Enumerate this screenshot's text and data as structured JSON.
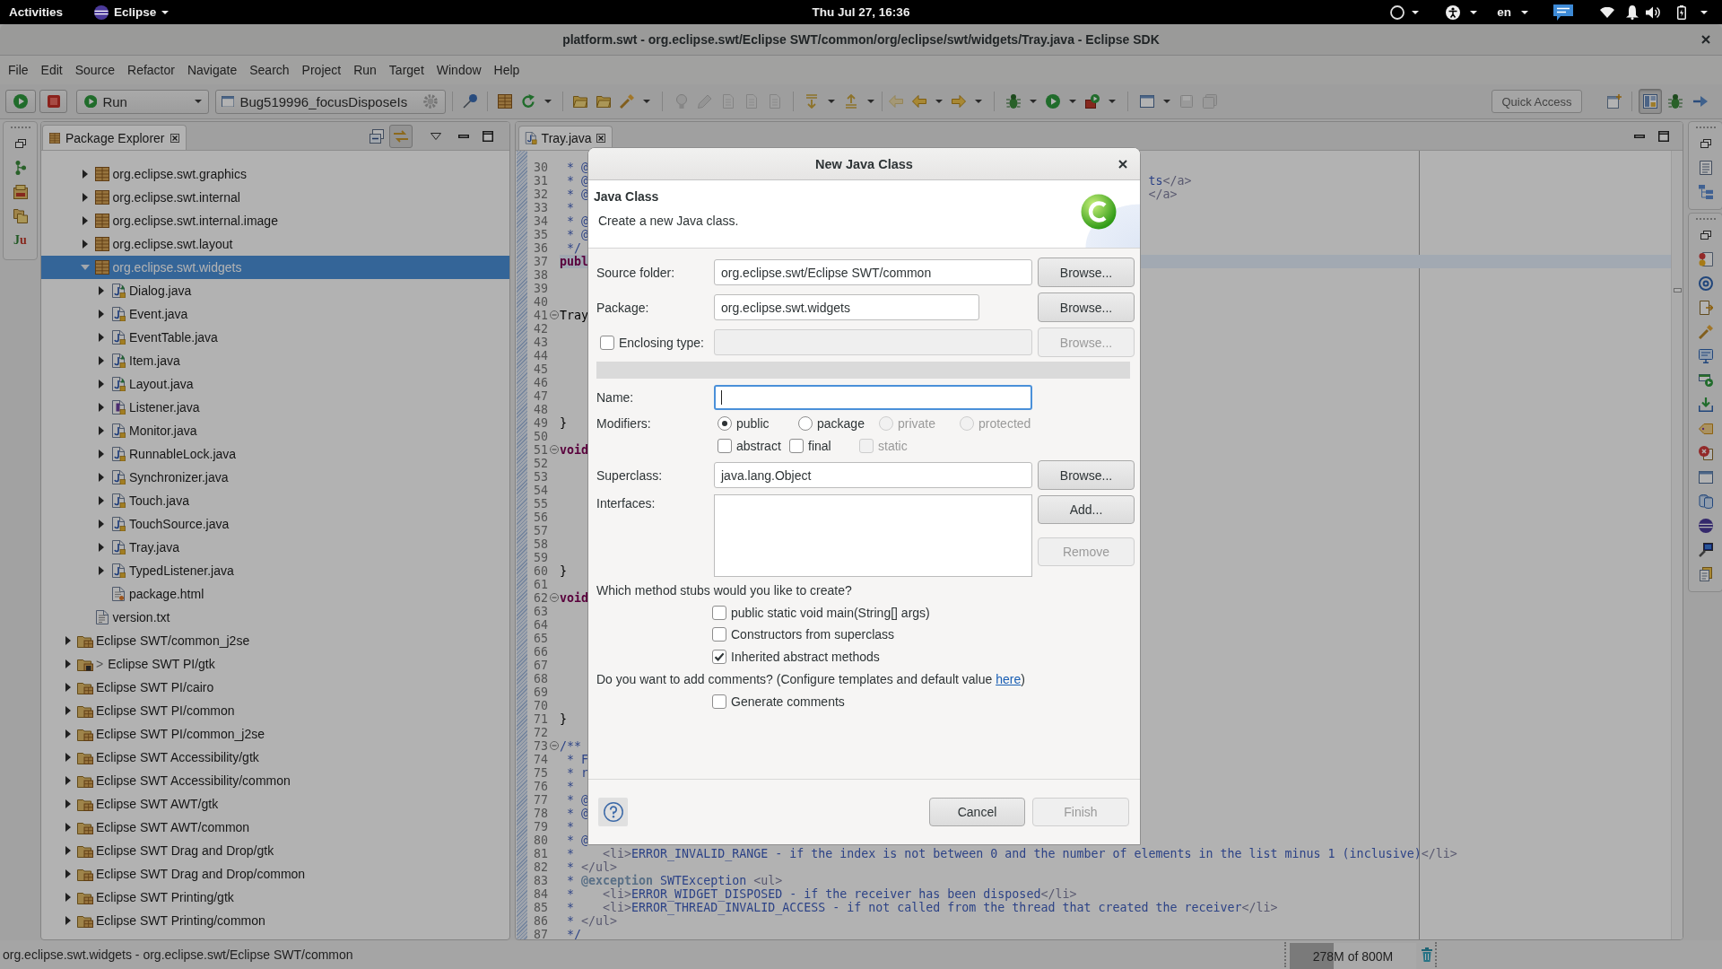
{
  "top_bar": {
    "activities": "Activities",
    "app_menu": "Eclipse",
    "clock": "Thu Jul 27, 16:36",
    "keyboard_layout": "en"
  },
  "window": {
    "title": "platform.swt - org.eclipse.swt/Eclipse SWT/common/org/eclipse/swt/widgets/Tray.java - Eclipse SDK"
  },
  "menu": [
    "File",
    "Edit",
    "Source",
    "Refactor",
    "Navigate",
    "Search",
    "Project",
    "Run",
    "Target",
    "Window",
    "Help"
  ],
  "toolbar": {
    "run_config": "Run",
    "launch_config": "Bug519996_focusDisposeIs",
    "quick_access": {
      "placeholder": "Quick Access"
    },
    "perspectives": [
      {
        "selected": true
      },
      {
        "selected": false
      },
      {
        "selected": false
      }
    ]
  },
  "left_trim": {
    "glyph": "Ju"
  },
  "package_explorer": {
    "tabs": [
      {
        "label": "Package Explorer",
        "selected": true
      }
    ],
    "view_toolbar": {
      "toggle_on": true
    },
    "tree": [
      {
        "children": [
          {
            "label": "org.eclipse.swt.graphics",
            "kind": "package",
            "expanded": false,
            "selected": false
          },
          {
            "label": "org.eclipse.swt.internal",
            "kind": "package",
            "expanded": false,
            "selected": false
          },
          {
            "label": "org.eclipse.swt.internal.image",
            "kind": "package",
            "expanded": false,
            "selected": false
          },
          {
            "label": "org.eclipse.swt.layout",
            "kind": "package",
            "expanded": false,
            "selected": false
          },
          {
            "label": "org.eclipse.swt.widgets",
            "kind": "package",
            "expanded": true,
            "selected": true,
            "children": [
              {
                "label": "Dialog.java",
                "kind": "abstract-class",
                "expanded": false,
                "selected": false
              },
              {
                "label": "Event.java",
                "kind": "class",
                "expanded": false,
                "selected": false
              },
              {
                "label": "EventTable.java",
                "kind": "class",
                "expanded": false,
                "selected": false
              },
              {
                "label": "Item.java",
                "kind": "abstract-class",
                "expanded": false,
                "selected": false
              },
              {
                "label": "Layout.java",
                "kind": "abstract-class",
                "expanded": false,
                "selected": false
              },
              {
                "label": "Listener.java",
                "kind": "interface",
                "expanded": false,
                "selected": false
              },
              {
                "label": "Monitor.java",
                "kind": "class",
                "expanded": false,
                "selected": false
              },
              {
                "label": "RunnableLock.java",
                "kind": "class",
                "expanded": false,
                "selected": false
              },
              {
                "label": "Synchronizer.java",
                "kind": "class",
                "expanded": false,
                "selected": false
              },
              {
                "label": "Touch.java",
                "kind": "class",
                "expanded": false,
                "selected": false
              },
              {
                "label": "TouchSource.java",
                "kind": "class",
                "expanded": false,
                "selected": false
              },
              {
                "label": "Tray.java",
                "kind": "class",
                "expanded": false,
                "selected": false
              },
              {
                "label": "TypedListener.java",
                "kind": "class",
                "expanded": false,
                "selected": false
              },
              {
                "label": "package.html",
                "kind": "html-file",
                "selected": false
              }
            ]
          },
          {
            "label": "version.txt",
            "kind": "text-file",
            "selected": false
          }
        ]
      },
      {
        "label": "Eclipse SWT/common_j2se",
        "kind": "source-folder",
        "expanded": false,
        "selected": false
      },
      {
        "label": "Eclipse SWT PI/gtk",
        "decoration": ">",
        "kind": "changed-source-folder",
        "expanded": false,
        "selected": false
      },
      {
        "label": "Eclipse SWT PI/cairo",
        "kind": "source-folder",
        "expanded": false,
        "selected": false
      },
      {
        "label": "Eclipse SWT PI/common",
        "kind": "source-folder",
        "expanded": false,
        "selected": false
      },
      {
        "label": "Eclipse SWT PI/common_j2se",
        "kind": "source-folder",
        "expanded": false,
        "selected": false
      },
      {
        "label": "Eclipse SWT Accessibility/gtk",
        "kind": "source-folder",
        "expanded": false,
        "selected": false
      },
      {
        "label": "Eclipse SWT Accessibility/common",
        "kind": "source-folder",
        "expanded": false,
        "selected": false
      },
      {
        "label": "Eclipse SWT AWT/gtk",
        "kind": "source-folder",
        "expanded": false,
        "selected": false
      },
      {
        "label": "Eclipse SWT AWT/common",
        "kind": "source-folder",
        "expanded": false,
        "selected": false
      },
      {
        "label": "Eclipse SWT Drag and Drop/gtk",
        "kind": "source-folder",
        "expanded": false,
        "selected": false
      },
      {
        "label": "Eclipse SWT Drag and Drop/common",
        "kind": "source-folder",
        "expanded": false,
        "selected": false
      },
      {
        "label": "Eclipse SWT Printing/gtk",
        "kind": "source-folder",
        "expanded": false,
        "selected": false
      },
      {
        "label": "Eclipse SWT Printing/common",
        "kind": "source-folder",
        "expanded": false,
        "selected": false
      }
    ]
  },
  "editor": {
    "tabs": [
      {
        "label": "Tray.java",
        "selected": true
      }
    ],
    "lines": [
      {
        "number": "30",
        "text": " * @",
        "kind": "comment",
        "current": false
      },
      {
        "number": "31",
        "text": " * @",
        "right": "ts</a>",
        "kind": "comment",
        "current": false
      },
      {
        "number": "32",
        "text": " * @",
        "right": "</a>",
        "kind": "comment",
        "current": false
      },
      {
        "number": "33",
        "text": " *",
        "kind": "comment",
        "current": false
      },
      {
        "number": "34",
        "text": " * @",
        "kind": "comment",
        "current": false
      },
      {
        "number": "35",
        "text": " * @",
        "kind": "comment",
        "current": false
      },
      {
        "number": "36",
        "text": " */",
        "kind": "comment",
        "current": false
      },
      {
        "number": "37",
        "text": "publ",
        "kind": "keyword",
        "current": true
      },
      {
        "number": "38",
        "current": false
      },
      {
        "number": "39",
        "current": false
      },
      {
        "number": "40",
        "current": false
      },
      {
        "number": "41",
        "text": "Tray",
        "kind": "code",
        "fold_expanded": true,
        "current": false
      },
      {
        "number": "42",
        "current": false
      },
      {
        "number": "43",
        "current": false
      },
      {
        "number": "44",
        "current": false
      },
      {
        "number": "45",
        "current": false
      },
      {
        "number": "46",
        "current": false
      },
      {
        "number": "47",
        "current": false
      },
      {
        "number": "48",
        "current": false
      },
      {
        "number": "49",
        "text": "}",
        "kind": "code",
        "current": false
      },
      {
        "number": "50",
        "current": false
      },
      {
        "number": "51",
        "text": "void",
        "kind": "keyword",
        "fold_expanded": true,
        "current": false
      },
      {
        "number": "52",
        "current": false
      },
      {
        "number": "53",
        "current": false
      },
      {
        "number": "54",
        "current": false
      },
      {
        "number": "55",
        "current": false
      },
      {
        "number": "56",
        "current": false
      },
      {
        "number": "57",
        "current": false
      },
      {
        "number": "58",
        "current": false
      },
      {
        "number": "59",
        "current": false
      },
      {
        "number": "60",
        "text": "}",
        "kind": "code",
        "current": false
      },
      {
        "number": "61",
        "current": false
      },
      {
        "number": "62",
        "text": "void",
        "kind": "keyword",
        "fold_expanded": true,
        "current": false
      },
      {
        "number": "63",
        "current": false
      },
      {
        "number": "64",
        "current": false
      },
      {
        "number": "65",
        "current": false
      },
      {
        "number": "66",
        "current": false
      },
      {
        "number": "67",
        "current": false
      },
      {
        "number": "68",
        "current": false
      },
      {
        "number": "69",
        "current": false
      },
      {
        "number": "70",
        "current": false
      },
      {
        "number": "71",
        "text": "}",
        "kind": "code",
        "current": false
      },
      {
        "number": "72",
        "current": false
      },
      {
        "number": "73",
        "text": "/**",
        "kind": "comment",
        "fold_expanded": true,
        "current": false
      },
      {
        "number": "74",
        "text": " * F",
        "kind": "comment",
        "current": false
      },
      {
        "number": "75",
        "text": " * r",
        "kind": "comment",
        "current": false
      },
      {
        "number": "76",
        "text": " *",
        "kind": "comment",
        "current": false
      },
      {
        "number": "77",
        "text": " * @",
        "kind": "comment",
        "current": false
      },
      {
        "number": "78",
        "text": " * @",
        "kind": "comment",
        "current": false
      },
      {
        "number": "79",
        "text": " *",
        "kind": "comment",
        "current": false
      },
      {
        "number": "80",
        "text": " * @",
        "kind": "comment",
        "current": false
      },
      {
        "number": "81",
        "text": " *    <li>ERROR_INVALID_RANGE - if the index is not between 0 and the number of elements in the list minus 1 (inclusive)</li>",
        "kind": "comment",
        "current": false
      },
      {
        "number": "82",
        "text": " * </ul>",
        "kind": "comment",
        "current": false
      },
      {
        "number": "83",
        "text": " * @exception SWTException <ul>",
        "kind": "comment",
        "current": false
      },
      {
        "number": "84",
        "text": " *    <li>ERROR_WIDGET_DISPOSED - if the receiver has been disposed</li>",
        "kind": "comment",
        "current": false
      },
      {
        "number": "85",
        "text": " *    <li>ERROR_THREAD_INVALID_ACCESS - if not called from the thread that created the receiver</li>",
        "kind": "comment",
        "current": false
      },
      {
        "number": "86",
        "text": " * </ul>",
        "kind": "comment",
        "current": false
      },
      {
        "number": "87",
        "text": " */",
        "kind": "comment",
        "current": false
      }
    ]
  },
  "status_bar": {
    "message": "org.eclipse.swt.widgets - org.eclipse.swt/Eclipse SWT/common",
    "heap": {
      "reading": "278M of 800M",
      "level": 0.35
    }
  },
  "dialog": {
    "title": "New Java Class",
    "heading": "Java Class",
    "description": "Create a new Java class.",
    "source_folder": {
      "label": "Source folder:",
      "value": "org.eclipse.swt/Eclipse SWT/common",
      "button": {
        "label": "Browse...",
        "disabled": false
      }
    },
    "package": {
      "label": "Package:",
      "value": "org.eclipse.swt.widgets",
      "button": {
        "label": "Browse...",
        "disabled": false
      }
    },
    "enclosing_type": {
      "label": "Enclosing type:",
      "checked": false,
      "field_disabled": true,
      "button": {
        "label": "Browse...",
        "disabled": true
      }
    },
    "name": {
      "label": "Name:",
      "focused": true
    },
    "modifiers": {
      "label": "Modifiers:",
      "access": [
        {
          "label": "public",
          "selected": true,
          "disabled": false
        },
        {
          "label": "package",
          "selected": false,
          "disabled": false
        },
        {
          "label": "private",
          "selected": false,
          "disabled": true
        },
        {
          "label": "protected",
          "selected": false,
          "disabled": true
        }
      ],
      "flags": [
        {
          "label": "abstract",
          "checked": false,
          "disabled": false
        },
        {
          "label": "final",
          "checked": false,
          "disabled": false
        },
        {
          "label": "static",
          "checked": false,
          "disabled": true
        }
      ]
    },
    "superclass": {
      "label": "Superclass:",
      "value": "java.lang.Object",
      "button": {
        "label": "Browse...",
        "disabled": false
      }
    },
    "interfaces": {
      "label": "Interfaces:",
      "add_button": {
        "label": "Add...",
        "disabled": false
      },
      "remove_button": {
        "label": "Remove",
        "disabled": true
      }
    },
    "stubs": {
      "question": "Which method stubs would you like to create?",
      "options": [
        {
          "label": "public static void main(String[] args)",
          "checked": false
        },
        {
          "label": "Constructors from superclass",
          "checked": false
        },
        {
          "label": "Inherited abstract methods",
          "checked": true
        }
      ]
    },
    "comments": {
      "question": "Do you want to add comments? (Configure templates and default value ",
      "link": "here",
      "question_end": ")",
      "options": [
        {
          "label": "Generate comments",
          "checked": false
        }
      ]
    },
    "buttons": [
      {
        "label": "Cancel",
        "disabled": false
      },
      {
        "label": "Finish",
        "disabled": true
      }
    ]
  }
}
